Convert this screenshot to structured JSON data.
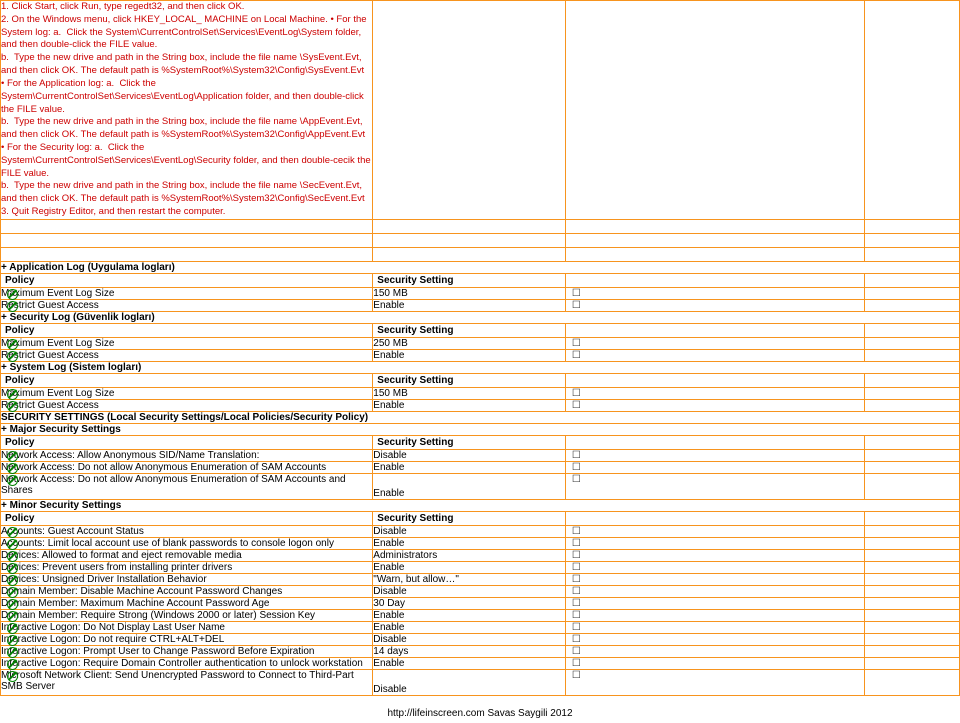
{
  "instructions": "1. Click Start, click Run, type regedt32, and then click OK.\n2. On the Windows menu, click HKEY_LOCAL_ MACHINE on Local Machine. • For the System log: a.  Click the System\\CurrentControlSet\\Services\\EventLog\\System folder, and then double-click the FILE value.\nb.  Type the new drive and path in the String box, include the file name \\SysEvent.Evt, and then click OK. The default path is %SystemRoot%\\System32\\Config\\SysEvent.Evt\n• For the Application log: a.  Click the System\\CurrentControlSet\\Services\\EventLog\\Application folder, and then double-click the FILE value.\nb.  Type the new drive and path in the String box, include the file name \\AppEvent.Evt, and then click OK. The default path is %SystemRoot%\\System32\\Config\\AppEvent.Evt\n• For the Security log: a.  Click the System\\CurrentControlSet\\Services\\EventLog\\Security folder, and then double-cecik the FILE value.\nb.  Type the new drive and path in the String box, include the file name \\SecEvent.Evt, and then click OK. The default path is %SystemRoot%\\System32\\Config\\SecEvent.Evt\n3. Quit Registry Editor, and then restart the computer.",
  "sections": {
    "app_log": {
      "title": "+ Application Log (Uygulama logları)",
      "col1": "Policy",
      "col2": "Security Setting",
      "rows": [
        {
          "policy": "Maximum Event Log Size",
          "value": "150 MB"
        },
        {
          "policy": "Restrict Guest Access",
          "value": "Enable"
        }
      ]
    },
    "sec_log": {
      "title": "+ Security Log (Güvenlik logları)",
      "col1": "Policy",
      "col2": "Security Setting",
      "rows": [
        {
          "policy": "Maximum Event Log Size",
          "value": "250 MB"
        },
        {
          "policy": "Restrict Guest Access",
          "value": "Enable"
        }
      ]
    },
    "sys_log": {
      "title": "+ System Log (Sistem logları)",
      "col1": "Policy",
      "col2": "Security Setting",
      "rows": [
        {
          "policy": "Maximum Event Log Size",
          "value": "150 MB"
        },
        {
          "policy": "Restrict Guest Access",
          "value": "Enable"
        }
      ]
    },
    "security_settings_hdr": "SECURITY SETTINGS (Local Security Settings/Local Policies/Security Policy)",
    "major": {
      "title": "+ Major Security Settings",
      "col1": "Policy",
      "col2": "Security Setting",
      "rows": [
        {
          "policy": "Network Access: Allow Anonymous SID/Name Translation:",
          "value": "Disable"
        },
        {
          "policy": "Network Access: Do not allow Anonymous Enumeration of SAM Accounts",
          "value": "Enable"
        },
        {
          "policy": "Network Access: Do not allow Anonymous Enumeration of SAM Accounts and Shares",
          "value": "Enable"
        }
      ]
    },
    "minor": {
      "title": "+ Minor Security Settings",
      "col1": "Policy",
      "col2": "Security Setting",
      "rows": [
        {
          "policy": "Accounts: Guest Account Status",
          "value": "Disable"
        },
        {
          "policy": "Accounts: Limit local account use of blank passwords to console logon only",
          "value": "Enable"
        },
        {
          "policy": "Devices: Allowed to format and eject removable media",
          "value": "Administrators"
        },
        {
          "policy": "Devices: Prevent users from installing printer drivers",
          "value": "Enable"
        },
        {
          "policy": "Devices: Unsigned Driver Installation Behavior",
          "value": "\"Warn, but allow…\""
        },
        {
          "policy": "Domain Member: Disable Machine Account Password Changes",
          "value": "Disable"
        },
        {
          "policy": "Domain Member: Maximum Machine Account Password Age",
          "value": "30 Day"
        },
        {
          "policy": "Domain Member: Require Strong (Windows 2000 or later) Session Key",
          "value": "Enable"
        },
        {
          "policy": "Interactive Logon: Do Not Display Last User Name",
          "value": "Enable"
        },
        {
          "policy": "Interactive Logon: Do not require CTRL+ALT+DEL",
          "value": "Disable"
        },
        {
          "policy": "Interactive Logon: Prompt User to Change Password Before Expiration",
          "value": "14 days"
        },
        {
          "policy": "Interactive Logon: Require Domain Controller authentication to unlock workstation",
          "value": "Enable"
        },
        {
          "policy": "Microsoft Network Client: Send Unencrypted Password to Connect to Third-Part SMB Server",
          "value": "Disable"
        }
      ]
    }
  },
  "footer": "http://lifeinscreen.com  Savas Saygili 2012"
}
